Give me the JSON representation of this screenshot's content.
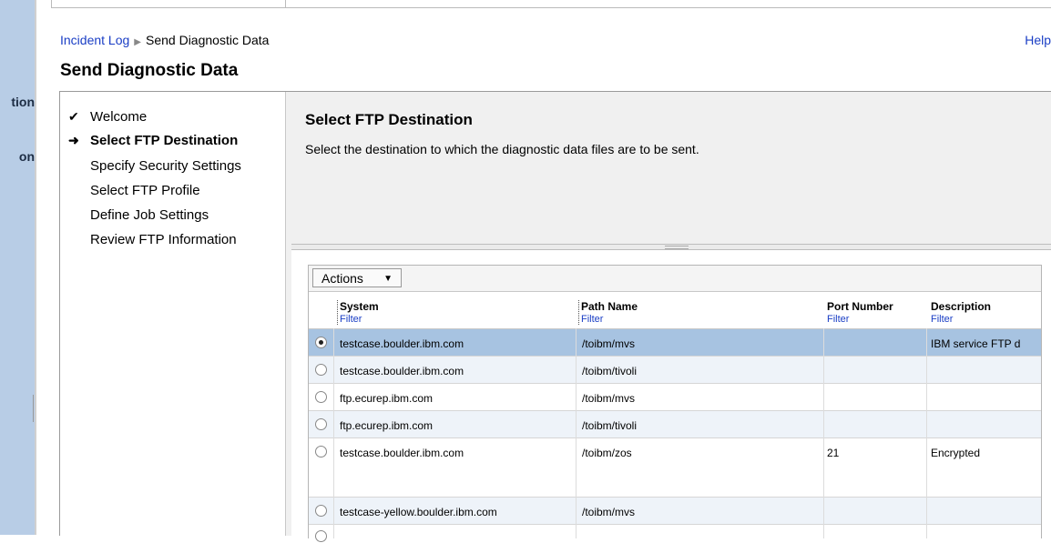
{
  "side_stubs": [
    "tion",
    "on"
  ],
  "breadcrumb": {
    "parent": "Incident Log",
    "current": "Send Diagnostic Data"
  },
  "help": "Help",
  "title": "Send Diagnostic Data",
  "steps": [
    {
      "label": "Welcome",
      "state": "done",
      "marker": "✔"
    },
    {
      "label": "Select FTP Destination",
      "state": "current",
      "marker": "➜"
    },
    {
      "label": "Specify Security Settings",
      "state": "todo"
    },
    {
      "label": "Select FTP Profile",
      "state": "todo"
    },
    {
      "label": "Define Job Settings",
      "state": "todo"
    },
    {
      "label": "Review FTP Information",
      "state": "todo"
    }
  ],
  "content": {
    "title": "Select FTP Destination",
    "description": "Select the destination to which the diagnostic data files are to be sent."
  },
  "table": {
    "actions_label": "Actions",
    "columns": [
      {
        "label": "System",
        "filter": "Filter"
      },
      {
        "label": "Path Name",
        "filter": "Filter"
      },
      {
        "label": "Port Number",
        "filter": "Filter"
      },
      {
        "label": "Description",
        "filter": "Filter"
      }
    ],
    "rows": [
      {
        "system": "testcase.boulder.ibm.com",
        "path": "/toibm/mvs",
        "port": "",
        "description": "IBM service FTP d",
        "selected": true
      },
      {
        "system": "testcase.boulder.ibm.com",
        "path": "/toibm/tivoli",
        "port": "",
        "description": "",
        "selected": false
      },
      {
        "system": "ftp.ecurep.ibm.com",
        "path": "/toibm/mvs",
        "port": "",
        "description": "",
        "selected": false
      },
      {
        "system": "ftp.ecurep.ibm.com",
        "path": "/toibm/tivoli",
        "port": "",
        "description": "",
        "selected": false
      },
      {
        "system": "testcase.boulder.ibm.com",
        "path": "/toibm/zos",
        "port": "21",
        "description": "Encrypted",
        "selected": false
      },
      {
        "system": "testcase-yellow.boulder.ibm.com",
        "path": "/toibm/mvs",
        "port": "",
        "description": "",
        "selected": false
      }
    ]
  },
  "colors": {
    "link": "#1a3ec5",
    "selected_row": "#a7c3e1",
    "alt_row": "#eef3f9",
    "left_strip": "#b8cde6"
  }
}
